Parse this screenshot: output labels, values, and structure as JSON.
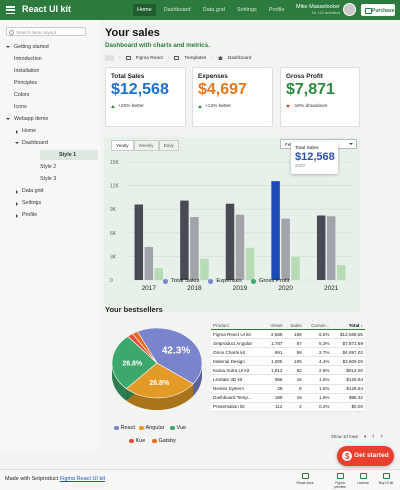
{
  "app": {
    "title": "React UI kit"
  },
  "topnav": {
    "items": [
      "Home",
      "Dashboard",
      "Data grid",
      "Settings",
      "Profile"
    ],
    "active": 0
  },
  "user": {
    "name": "Mike Masselocker",
    "role": "Dr. UX architect"
  },
  "purchase_label": "Purchase",
  "sidebar": {
    "search_placeholder": "Search demo layout",
    "items": [
      {
        "label": "Getting started"
      },
      {
        "label": "Introduction"
      },
      {
        "label": "Installation"
      },
      {
        "label": "Principles"
      },
      {
        "label": "Colors"
      },
      {
        "label": "Icons"
      },
      {
        "label": "Webapp demo"
      },
      {
        "label": "Home"
      },
      {
        "label": "Dashboard"
      },
      {
        "label": "Style 1"
      },
      {
        "label": "Style 2"
      },
      {
        "label": "Style 3"
      },
      {
        "label": "Data grid"
      },
      {
        "label": "Settings"
      },
      {
        "label": "Profile"
      }
    ]
  },
  "page": {
    "title": "Your sales",
    "subtitle": "Dashboard with charts and metrics."
  },
  "breadcrumb": [
    "Figma React",
    "Templates",
    "Dashboard"
  ],
  "kpis": [
    {
      "title": "Total Sales",
      "value": "$12,568",
      "delta": "+25% better",
      "color": "#1e6fd1",
      "dir": "up"
    },
    {
      "title": "Expenses",
      "value": "$4,697",
      "delta": "+12% better",
      "color": "#e8761a",
      "dir": "up"
    },
    {
      "title": "Gross Profit",
      "value": "$7,871",
      "delta": "-16% drowdown",
      "color": "#2d8a3c",
      "dir": "down"
    }
  ],
  "chart_tabs": [
    "Yearly",
    "Weekly",
    "Daily"
  ],
  "date_range": "Feb 3, 2021 - Mar 3, 2021",
  "tooltip": {
    "label": "Total Sales",
    "value": "$12,568",
    "year": "2020"
  },
  "bestsellers_title": "Your bestsellers",
  "chart_data": [
    {
      "type": "bar",
      "categories": [
        "2017",
        "2018",
        "2019",
        "2020",
        "2021"
      ],
      "series": [
        {
          "name": "Total Sales",
          "color": "#4a4a55",
          "values": [
            9600,
            10100,
            9700,
            12568,
            8200
          ]
        },
        {
          "name": "Expenses",
          "color": "#a3a3ab",
          "values": [
            4200,
            8000,
            8300,
            7800,
            8100
          ]
        },
        {
          "name": "Gross Profit",
          "color": "#b7dbb5",
          "values": [
            1500,
            2700,
            4100,
            2900,
            1900
          ]
        }
      ],
      "ylim": [
        0,
        15000
      ],
      "yticks": [
        "0",
        "3K",
        "6K",
        "9K",
        "12K",
        "15K"
      ],
      "highlight_color": "#1b4bb8",
      "highlight": {
        "series": 0,
        "index": 3
      },
      "grid": true,
      "legend": "bottom"
    },
    {
      "type": "pie",
      "labels": [
        "React",
        "Angular",
        "Vue",
        "Kue",
        "Gatsby"
      ],
      "values": [
        42.3,
        26.8,
        26.8,
        2.05,
        2.05
      ],
      "colors": [
        "#7a84cc",
        "#e39a26",
        "#3ca86c",
        "#ea4a3a",
        "#e36b1e"
      ],
      "legend": "bottom"
    }
  ],
  "table": {
    "columns": [
      "Product",
      "Views",
      "Sales",
      "Conver...",
      "Total"
    ],
    "rows": [
      [
        "Figma React UI kit",
        "2,568",
        "168",
        "6.5%",
        "$12,568.55"
      ],
      [
        "Setproduct Angular",
        "1,787",
        "87",
        "5.3%",
        "$7,871.69"
      ],
      [
        "Orion Charts kit",
        "691",
        "69",
        "2.7%",
        "$4,697.02"
      ],
      [
        "Material Design",
        "1,005",
        "105",
        "4.4%",
        "$3,609.00"
      ],
      [
        "Kama Sutra UI kit",
        "1,812",
        "82",
        "2.6%",
        "$812.00"
      ],
      [
        "Levitate 3D kit",
        "966",
        "16",
        "1.5%",
        "$128.64"
      ],
      [
        "Neolex System",
        "28",
        "8",
        "1.6%",
        "$128.64"
      ],
      [
        "Dashboard Temp...",
        "189",
        "19",
        "1.6%",
        "$96.32"
      ],
      [
        "Presentation kit",
        "112",
        "2",
        "0.2%",
        "$0.00"
      ]
    ]
  },
  "pagination": {
    "show": "Show 10 rows",
    "prev": "‹",
    "next": "›"
  },
  "fab_label": "Get started",
  "footer": {
    "prefix": "Made with Setproduct",
    "link": "Figma React UI kit",
    "items": [
      "React docs",
      "Figma preview",
      "License",
      "Buy UI kit"
    ]
  }
}
